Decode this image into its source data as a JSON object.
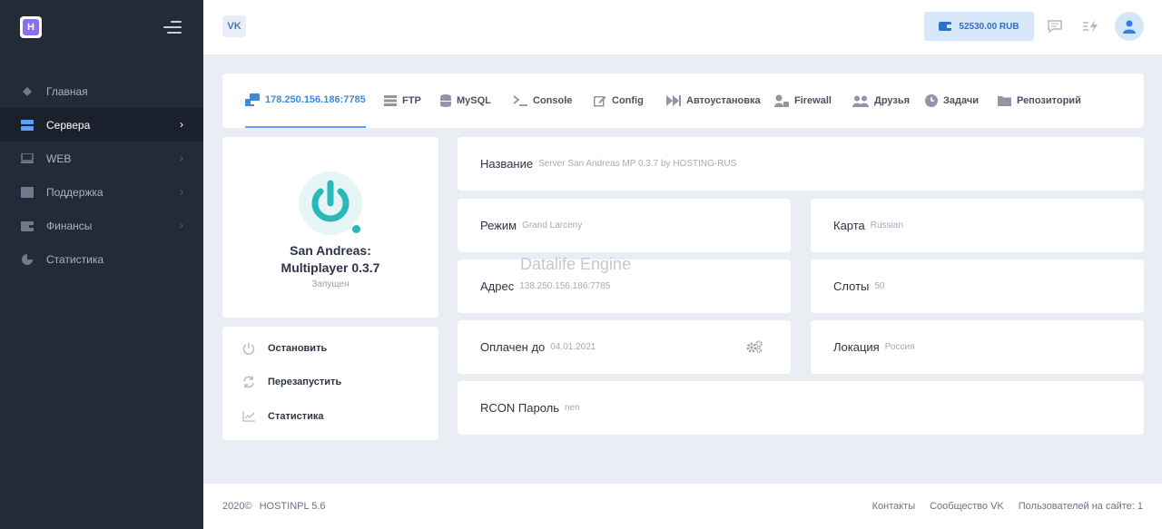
{
  "sidebar": {
    "items": [
      {
        "label": "Главная",
        "icon": "home-icon",
        "chevron": false,
        "active": false
      },
      {
        "label": "Сервера",
        "icon": "servers-icon",
        "chevron": true,
        "active": true
      },
      {
        "label": "WEB",
        "icon": "monitor-icon",
        "chevron": true,
        "active": false
      },
      {
        "label": "Поддержка",
        "icon": "support-icon",
        "chevron": true,
        "active": false
      },
      {
        "label": "Финансы",
        "icon": "wallet-icon",
        "chevron": true,
        "active": false
      },
      {
        "label": "Статистика",
        "icon": "pie-chart-icon",
        "chevron": false,
        "active": false
      }
    ]
  },
  "header": {
    "vk_label": "VK",
    "balance": "52530.00 RUB"
  },
  "tabs": [
    {
      "label": "178.250.156.186:7785",
      "icon": "network-icon",
      "active": true
    },
    {
      "label": "FTP",
      "icon": "server-rack-icon"
    },
    {
      "label": "MySQL",
      "icon": "database-icon"
    },
    {
      "label": "Console",
      "icon": "terminal-icon"
    },
    {
      "label": "Config",
      "icon": "edit-icon"
    },
    {
      "label": "Автоустановка",
      "icon": "fast-forward-icon"
    },
    {
      "label": "Firewall",
      "icon": "user-lock-icon"
    },
    {
      "label": "Друзья",
      "icon": "users-icon"
    },
    {
      "label": "Задачи",
      "icon": "clock-icon"
    },
    {
      "label": "Репозиторий",
      "icon": "folder-icon"
    }
  ],
  "server": {
    "name_line1": "San Andreas:",
    "name_line2": "Multiplayer 0.3.7",
    "status": "Запущен",
    "status_color": "#2ab8b8"
  },
  "actions": {
    "stop": "Остановить",
    "restart": "Перезапустить",
    "stats": "Статистика"
  },
  "info": {
    "name_label": "Название",
    "name_value": "Server San Andreas MP 0.3.7 by HOSTING-RUS",
    "mode_label": "Режим",
    "mode_value": "Grand Larceny",
    "map_label": "Карта",
    "map_value": "Russian",
    "address_label": "Адрес",
    "address_value": "138.250.156.186:7785",
    "slots_label": "Слоты",
    "slots_value": "50",
    "paid_label": "Оплачен до",
    "paid_value": "04.01.2021",
    "location_label": "Локация",
    "location_value": "Россия",
    "rcon_label": "RCON Пароль",
    "rcon_value": "nen"
  },
  "watermark": "Datalife Engine",
  "footer": {
    "year": "2020©",
    "version": "HOSTINPL 5.6",
    "contacts": "Контакты",
    "community": "Сообщество VK",
    "online": "Пользователей на сайте: 1"
  }
}
